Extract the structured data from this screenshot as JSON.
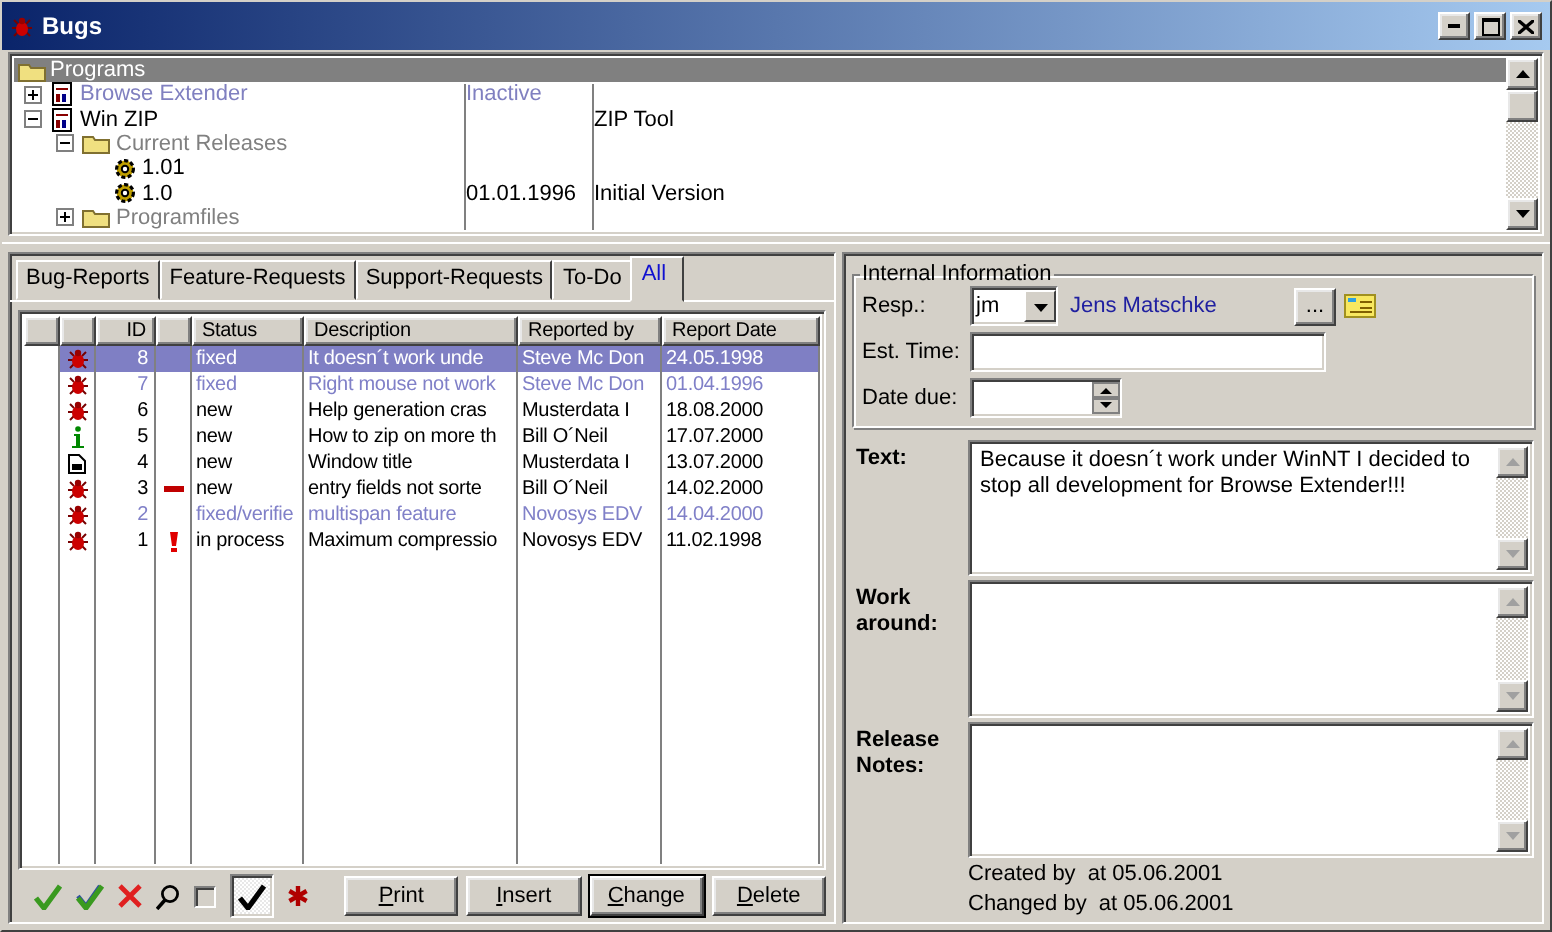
{
  "window": {
    "title": "Bugs"
  },
  "tree": {
    "header": "Programs",
    "items": [
      {
        "label": "Browse Extender",
        "kind": "program",
        "expanded": false,
        "inactive": true,
        "col_2": "Inactive"
      },
      {
        "label": "Win ZIP",
        "kind": "program",
        "expanded": true,
        "inactive": false,
        "col_3": "ZIP Tool",
        "children": [
          {
            "label": "Current Releases",
            "kind": "folder",
            "expanded": true,
            "inactive": false,
            "children": [
              {
                "label": "1.01",
                "kind": "release",
                "inactive": false
              },
              {
                "label": "1.0",
                "kind": "release",
                "inactive": false,
                "col_2": "01.01.1996",
                "col_3": "Initial Version"
              }
            ]
          },
          {
            "label": "Programfiles",
            "kind": "folder",
            "expanded": false,
            "inactive": false
          }
        ]
      }
    ]
  },
  "tabs": [
    {
      "label": "Bug-Reports",
      "selected": false
    },
    {
      "label": "Feature-Requests",
      "selected": false
    },
    {
      "label": "Support-Requests",
      "selected": false
    },
    {
      "label": "To-Do",
      "selected": false
    },
    {
      "label": "All",
      "selected": true
    }
  ],
  "table": {
    "columns": [
      "ID",
      "Status",
      "Description",
      "Reported by",
      "Report Date"
    ],
    "rows": [
      {
        "kind": "bug",
        "id": "8",
        "status": "fixed",
        "description": "It doesn´t work unde",
        "reported_by": "Steve Mc Don",
        "report_date": "24.05.1998",
        "selected": true,
        "inactive": true
      },
      {
        "kind": "bug",
        "id": "7",
        "status": "fixed",
        "description": "Right mouse not work",
        "reported_by": "Steve Mc Don",
        "report_date": "01.04.1996",
        "selected": false,
        "inactive": true
      },
      {
        "kind": "bug",
        "id": "6",
        "status": "new",
        "description": "Help generation cras",
        "reported_by": "Musterdata I",
        "report_date": "18.08.2000",
        "selected": false,
        "inactive": false
      },
      {
        "kind": "info",
        "id": "5",
        "status": "new",
        "description": "How to zip on more th",
        "reported_by": "Bill O´Neil",
        "report_date": "17.07.2000",
        "selected": false,
        "inactive": false
      },
      {
        "kind": "document",
        "id": "4",
        "status": "new",
        "description": "Window title",
        "reported_by": "Musterdata I",
        "report_date": "13.07.2000",
        "selected": false,
        "inactive": false
      },
      {
        "kind": "bug",
        "priority_mark": {
          "kind": "dash"
        },
        "id": "3",
        "status": "new",
        "description": "entry fields not sorte",
        "reported_by": "Bill O´Neil",
        "report_date": "14.02.2000",
        "selected": false,
        "inactive": false
      },
      {
        "kind": "bug",
        "id": "2",
        "status": "fixed/verifie",
        "description": "multispan feature",
        "reported_by": "Novosys EDV",
        "report_date": "14.04.2000",
        "selected": false,
        "inactive": true
      },
      {
        "kind": "bug",
        "priority_mark": {
          "kind": "exclamation"
        },
        "id": "1",
        "status": "in process",
        "description": "Maximum compressio",
        "reported_by": "Novosys EDV",
        "report_date": "11.02.1998",
        "selected": false,
        "inactive": false
      }
    ]
  },
  "toolbar": {
    "tools": [
      {
        "kind": "check"
      },
      {
        "kind": "check-all"
      },
      {
        "kind": "cross"
      },
      {
        "kind": "search"
      },
      {
        "kind": "checkbox",
        "checked": false
      },
      {
        "kind": "toggle",
        "pressed": true
      },
      {
        "kind": "asterisk"
      }
    ],
    "buttons": [
      {
        "label": "Print",
        "default": false
      },
      {
        "label": "Insert",
        "default": false
      },
      {
        "label": "Change",
        "default": true
      },
      {
        "label": "Delete",
        "default": false
      }
    ]
  },
  "details": {
    "group_title": "Internal Information",
    "resp_label": "Resp.:",
    "resp_value": "jm",
    "resp_name": "Jens Matschke",
    "browse_button": "...",
    "est_time_label": "Est. Time:",
    "date_due_label": "Date due:",
    "memos": [
      {
        "label": "Text:",
        "value": "Because it doesn´t work under WinNT I decided to stop all development for Browse Extender!!!"
      },
      {
        "label": "Work around:"
      },
      {
        "label": "Release Notes:"
      }
    ],
    "created": "Created by  at 05.06.2001",
    "changed": "Changed by  at 05.06.2001"
  }
}
